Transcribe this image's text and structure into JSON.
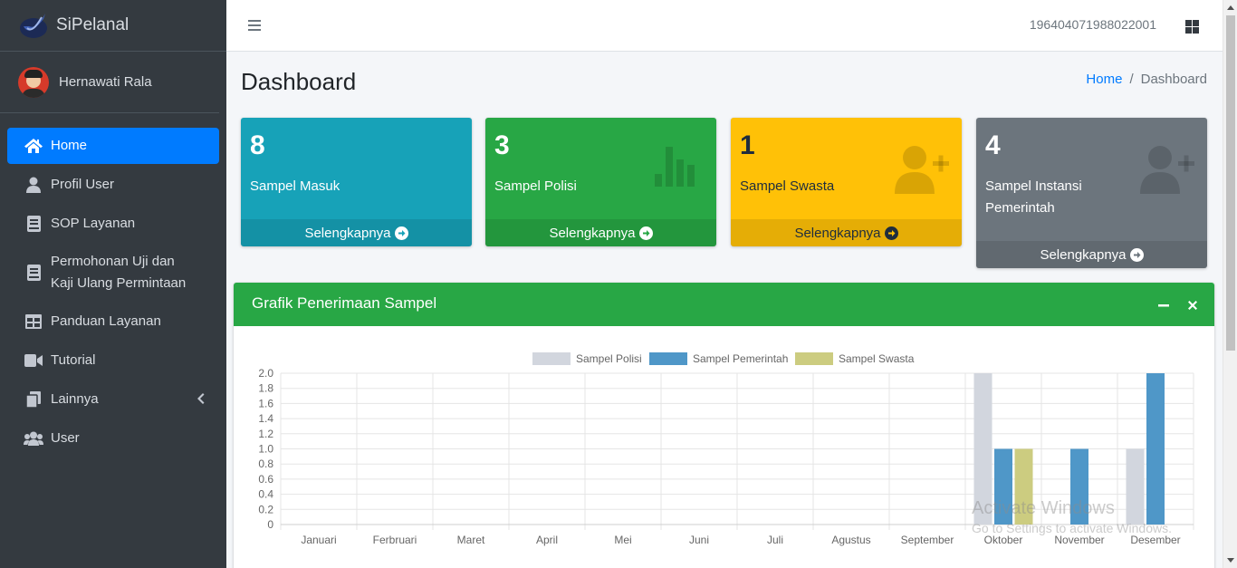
{
  "brand": {
    "name": "SiPelanal"
  },
  "user": {
    "name": "Hernawati Rala",
    "id": "196404071988022001"
  },
  "nav": [
    {
      "label": "Home",
      "icon": "home-icon"
    },
    {
      "label": "Profil User",
      "icon": "user-icon"
    },
    {
      "label": "SOP Layanan",
      "icon": "book-icon"
    },
    {
      "label": "Permohonan Uji dan Kaji Ulang Permintaan",
      "icon": "book-icon"
    },
    {
      "label": "Panduan Layanan",
      "icon": "table-icon"
    },
    {
      "label": "Tutorial",
      "icon": "video-icon"
    },
    {
      "label": "Lainnya",
      "icon": "copy-icon"
    },
    {
      "label": "User",
      "icon": "users-icon"
    }
  ],
  "page": {
    "title": "Dashboard"
  },
  "breadcrumb": {
    "home": "Home",
    "current": "Dashboard"
  },
  "boxes": [
    {
      "value": "8",
      "label": "Sampel Masuk",
      "more": "Selengkapnya",
      "color": "#17a2b8"
    },
    {
      "value": "3",
      "label": "Sampel Polisi",
      "more": "Selengkapnya",
      "color": "#28a745"
    },
    {
      "value": "1",
      "label": "Sampel Swasta",
      "more": "Selengkapnya",
      "color": "#ffc107"
    },
    {
      "value": "4",
      "label": "Sampel Instansi Pemerintah",
      "more": "Selengkapnya",
      "color": "#6c757d"
    }
  ],
  "card": {
    "title": "Grafik Penerimaan Sampel"
  },
  "chart_data": {
    "type": "bar",
    "categories": [
      "Januari",
      "Ferbruari",
      "Maret",
      "April",
      "Mei",
      "Juni",
      "Juli",
      "Agustus",
      "September",
      "Oktober",
      "November",
      "Desember"
    ],
    "series": [
      {
        "name": "Sampel Polisi",
        "color": "#d2d6de",
        "values": [
          0,
          0,
          0,
          0,
          0,
          0,
          0,
          0,
          0,
          2,
          0,
          1
        ]
      },
      {
        "name": "Sampel Pemerintah",
        "color": "#4f97c8",
        "values": [
          0,
          0,
          0,
          0,
          0,
          0,
          0,
          0,
          0,
          1,
          1,
          2
        ]
      },
      {
        "name": "Sampel Swasta",
        "color": "#cccc80",
        "values": [
          0,
          0,
          0,
          0,
          0,
          0,
          0,
          0,
          0,
          1,
          0,
          0
        ]
      }
    ],
    "ylim": [
      0,
      2
    ],
    "yticks": [
      "0",
      "0.2",
      "0.4",
      "0.6",
      "0.8",
      "1.0",
      "1.2",
      "1.4",
      "1.6",
      "1.8",
      "2.0"
    ],
    "grid": true,
    "legend": "top"
  },
  "watermark": {
    "line1": "Activate Windows",
    "line2": "Go to Settings to activate Windows."
  }
}
